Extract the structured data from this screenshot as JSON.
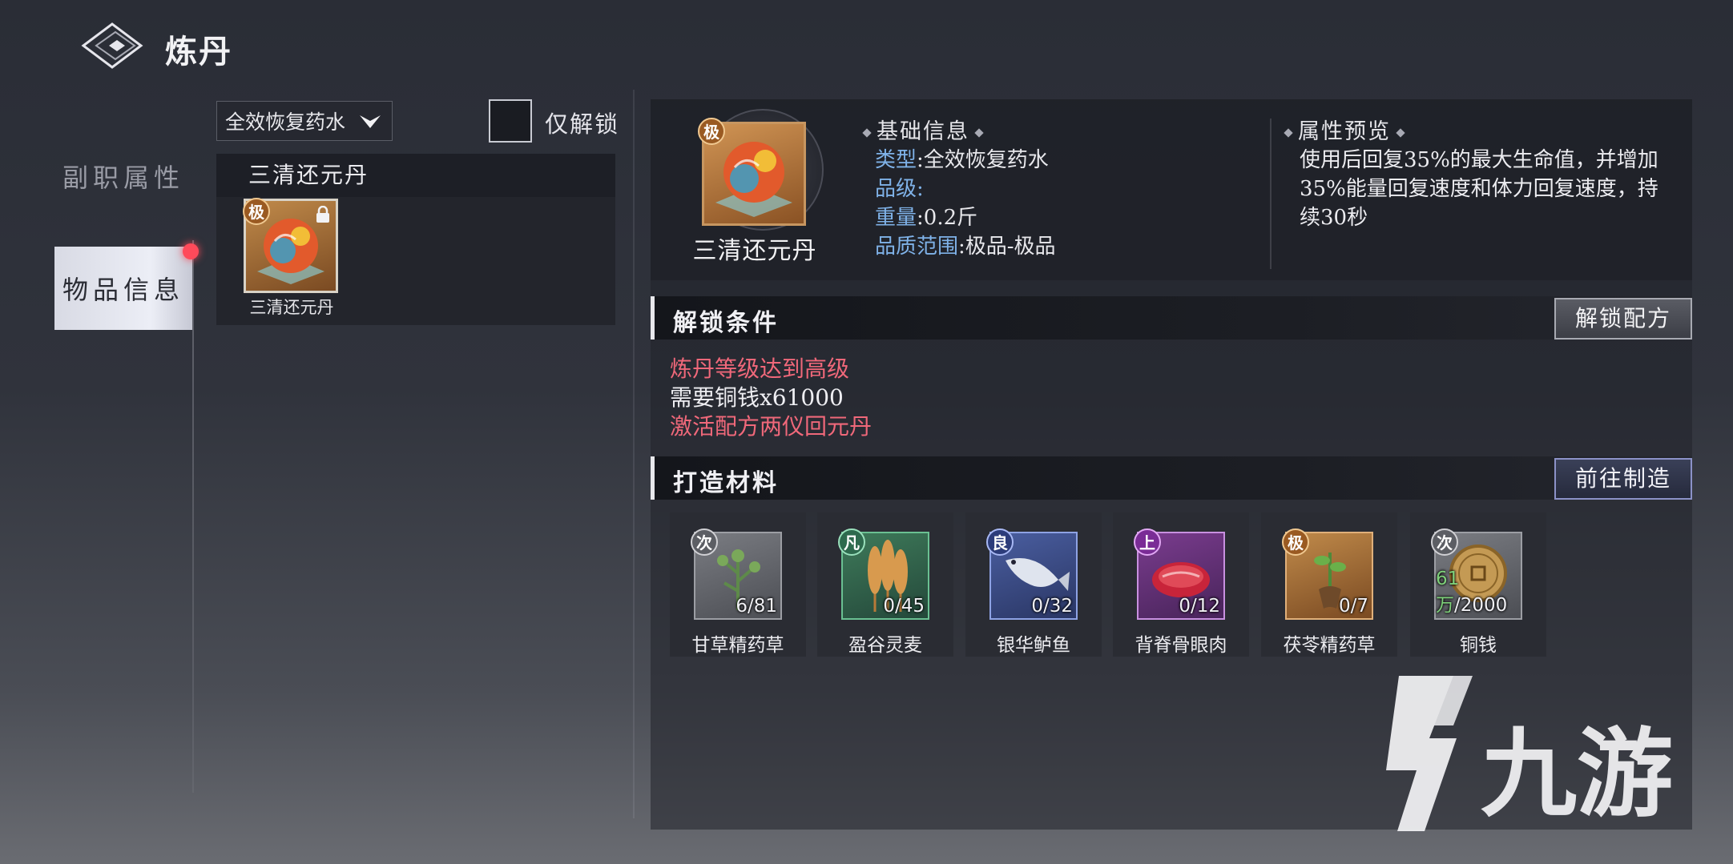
{
  "header": {
    "title": "炼丹"
  },
  "tabs": [
    {
      "label": "副职属性"
    },
    {
      "label": "物品信息"
    }
  ],
  "filter": {
    "selected": "全效恢复药水",
    "unlock_only_label": "仅解锁"
  },
  "recipe_list": {
    "group_title": "三清还元丹",
    "items": [
      {
        "name": "三清还元丹",
        "grade": "极"
      }
    ]
  },
  "product": {
    "name": "三清还元丹",
    "grade": "极",
    "basic_info_title": "基础信息",
    "rows": [
      {
        "key": "类型",
        "value": ":全效恢复药水"
      },
      {
        "key": "品级",
        "value": ":"
      },
      {
        "key": "重量",
        "value": ":0.2斤"
      },
      {
        "key": "品质范围",
        "value": ":极品-极品"
      }
    ],
    "attr_title": "属性预览",
    "attr_desc": "使用后回复35%的最大生命值，并增加35%能量回复速度和体力回复速度，持续30秒"
  },
  "unlock": {
    "title": "解锁条件",
    "button": "解锁配方",
    "conditions": [
      {
        "text": "炼丹等级达到高级"
      },
      {
        "text": "需要铜钱x61000"
      },
      {
        "text": "激活配方两仪回元丹"
      }
    ]
  },
  "materials": {
    "title": "打造材料",
    "button": "前往制造",
    "items": [
      {
        "name": "甘草精药草",
        "grade": "次",
        "have": "6",
        "need": "/81"
      },
      {
        "name": "盈谷灵麦",
        "grade": "凡",
        "have": "0",
        "need": "/45"
      },
      {
        "name": "银华鲈鱼",
        "grade": "良",
        "have": "0",
        "need": "/32"
      },
      {
        "name": "背脊骨眼肉",
        "grade": "上",
        "have": "0",
        "need": "/12"
      },
      {
        "name": "茯苓精药草",
        "grade": "极",
        "have": "0",
        "need": "/7"
      },
      {
        "name": "铜钱",
        "grade": "次",
        "have": "61万",
        "need": "/2000"
      }
    ]
  },
  "watermark": {
    "text": "九游"
  }
}
